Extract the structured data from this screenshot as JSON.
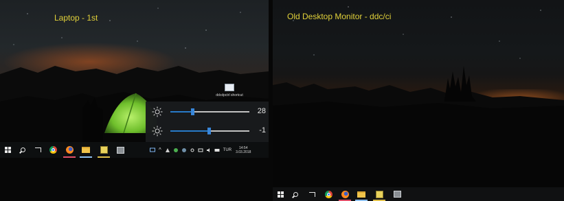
{
  "screens": {
    "left": {
      "title": "Laptop - 1st",
      "desktop_icon_label": "ddcdpctrl shortcut"
    },
    "right": {
      "title": "Old Desktop Monitor - ddc/ci"
    }
  },
  "brightness_flyout": {
    "sliders": [
      {
        "name": "laptop",
        "value_text": "28",
        "fraction": 0.28
      },
      {
        "name": "monitor",
        "value_text": "-1",
        "fraction": 0.49
      }
    ]
  },
  "taskbar_left": {
    "buttons": [
      "windows-start",
      "search",
      "task-view",
      "chrome",
      "firefox",
      "file-explorer",
      "sticky-notes",
      "app"
    ],
    "tray": {
      "language": "TUR",
      "time": "14:54",
      "date": "3.03.2018"
    }
  },
  "taskbar_right": {
    "buttons": [
      "windows-start",
      "search",
      "task-view",
      "chrome",
      "firefox",
      "file-explorer",
      "sticky-notes",
      "app"
    ]
  },
  "colors": {
    "title_yellow": "#e1d13a",
    "slider_blue": "#3a8be0",
    "tent_green": "#7fd43a"
  }
}
